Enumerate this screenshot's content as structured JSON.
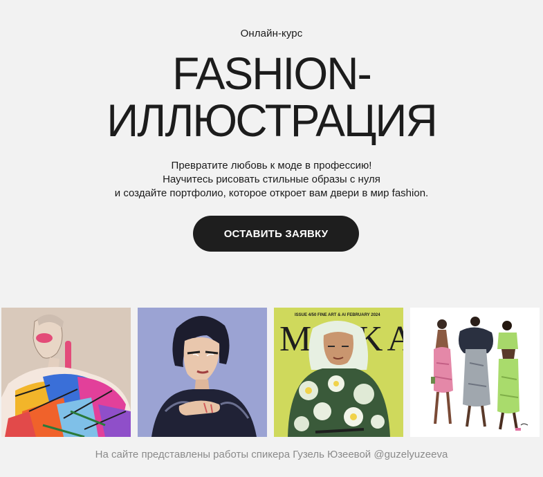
{
  "hero": {
    "eyebrow": "Онлайн-курс",
    "title_line1": "FASHION-",
    "title_line2": "ИЛЛЮСТРАЦИЯ",
    "desc_line1": "Превратите любовь к моде в профессию!",
    "desc_line2": "Научитесь рисовать стильные образы с нуля",
    "desc_line3": "и создайте портфолио, которое откроет вам двери в мир fashion.",
    "cta_label": "ОСТАВИТЬ ЗАЯВКУ"
  },
  "gallery": {
    "items": [
      {
        "name": "illustration-colorful-jacket",
        "bg": "#d8c8ba"
      },
      {
        "name": "illustration-woman-bob-hair",
        "bg": "#9aa3d2"
      },
      {
        "name": "illustration-magazine-cover",
        "bg": "#cfd85a",
        "cover_meta": "ISSUE 4/50   FINE ART & AI   FEBRUARY 2024",
        "cover_title": "MA KA"
      },
      {
        "name": "illustration-three-models",
        "bg": "#ffffff"
      }
    ]
  },
  "footer": {
    "credit": "На сайте представлены работы спикера Гузель Юзеевой @guzelyuzeeva"
  },
  "colors": {
    "background": "#f2f2f2",
    "button": "#1e1e1e",
    "text": "#1a1a1a",
    "muted": "#8a8a8a"
  }
}
